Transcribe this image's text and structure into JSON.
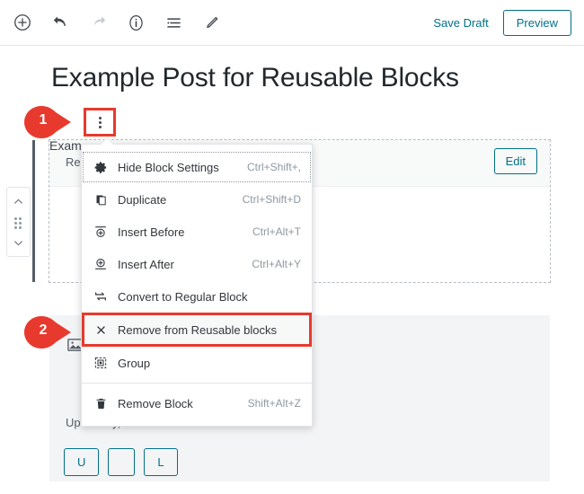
{
  "toolbar": {
    "left_icons": [
      {
        "name": "add-block-icon",
        "label": "Add block"
      },
      {
        "name": "undo-icon",
        "label": "Undo"
      },
      {
        "name": "redo-icon",
        "label": "Redo"
      },
      {
        "name": "info-icon",
        "label": "Content structure"
      },
      {
        "name": "block-navigation-icon",
        "label": "Block navigation"
      },
      {
        "name": "pencil-icon",
        "label": "Edit"
      }
    ],
    "save_draft_label": "Save Draft",
    "preview_label": "Preview"
  },
  "post": {
    "title": "Example Post for Reusable Blocks",
    "reusable_block_label": "Reusa",
    "reusable_edit_label": "Edit",
    "reusable_body_text": "Exam"
  },
  "mover": {
    "up_icon": "chevron-up-icon",
    "drag_icon": "drag-handle-icon",
    "down_icon": "chevron-down-icon"
  },
  "more_button": {
    "icon": "three-dots-vertical-icon",
    "label": "More options"
  },
  "menu": {
    "groups": [
      {
        "items": [
          {
            "icon": "gear-icon",
            "label": "Hide Block Settings",
            "shortcut": "Ctrl+Shift+,",
            "state": "focused"
          },
          {
            "icon": "duplicate-icon",
            "label": "Duplicate",
            "shortcut": "Ctrl+Shift+D",
            "state": "normal"
          },
          {
            "icon": "insert-before-icon",
            "label": "Insert Before",
            "shortcut": "Ctrl+Alt+T",
            "state": "normal"
          },
          {
            "icon": "insert-after-icon",
            "label": "Insert After",
            "shortcut": "Ctrl+Alt+Y",
            "state": "normal"
          },
          {
            "icon": "convert-icon",
            "label": "Convert to Regular Block",
            "shortcut": "",
            "state": "normal"
          },
          {
            "icon": "close-x-icon",
            "label": "Remove from Reusable blocks",
            "shortcut": "",
            "state": "highlighted"
          },
          {
            "icon": "group-icon",
            "label": "Group",
            "shortcut": "",
            "state": "normal"
          }
        ]
      },
      {
        "items": [
          {
            "icon": "trash-icon",
            "label": "Remove Block",
            "shortcut": "Shift+Alt+Z",
            "state": "normal"
          }
        ]
      }
    ]
  },
  "image_block": {
    "icon": "image-icon",
    "help_text": "Upl                                              library, or add one with a URL.",
    "buttons": [
      "U",
      "",
      "L"
    ]
  },
  "callouts": [
    {
      "number": "1",
      "target": "more-options-button"
    },
    {
      "number": "2",
      "target": "remove-from-reusable-blocks-item"
    }
  ],
  "colors": {
    "accent": "#007087",
    "callout_red": "#e8392e",
    "canvas": "#ffffff",
    "page_bg": "#f1f1f1",
    "placeholder_bg": "#f3f4f5"
  }
}
